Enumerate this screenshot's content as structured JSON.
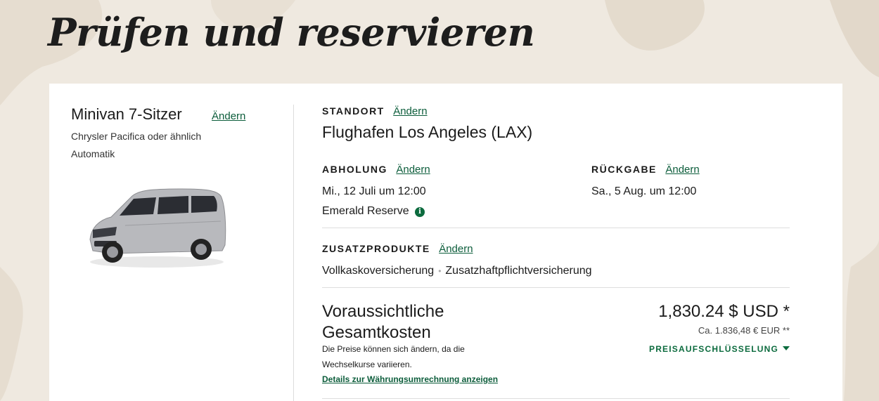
{
  "page_title": "Prüfen und reservieren",
  "vehicle": {
    "name": "Minivan 7-Sitzer",
    "change_label": "Ändern",
    "model": "Chrysler Pacifica oder ähnlich",
    "transmission": "Automatik",
    "color": "#b8b9bd"
  },
  "location": {
    "label": "STANDORT",
    "change_label": "Ändern",
    "name": "Flughafen Los Angeles (LAX)"
  },
  "pickup": {
    "label": "ABHOLUNG",
    "change_label": "Ändern",
    "datetime": "Mi., 12 Juli um 12:00",
    "program": "Emerald Reserve",
    "info_icon": "info-icon"
  },
  "return": {
    "label": "RÜCKGABE",
    "change_label": "Ändern",
    "datetime": "Sa., 5 Aug. um 12:00"
  },
  "extras": {
    "label": "ZUSATZPRODUKTE",
    "change_label": "Ändern",
    "items": [
      "Vollkaskoversicherung",
      "Zusatzhaftpflichtversicherung"
    ]
  },
  "total": {
    "title_line1": "Voraussichtliche",
    "title_line2": "Gesamtkosten",
    "note_line1": "Die Preise können sich ändern, da die",
    "note_line2": "Wechselkurse variieren.",
    "currency_link": "Details zur Währungsumrechnung anzeigen",
    "price_usd": "1,830.24 $ USD *",
    "price_eur": "Ca. 1.836,48 € EUR **",
    "breakdown_label": "PREISAUFSCHLÜSSELUNG"
  },
  "colors": {
    "accent": "#0c5d3b",
    "background": "#efe9e0",
    "card": "#ffffff"
  }
}
